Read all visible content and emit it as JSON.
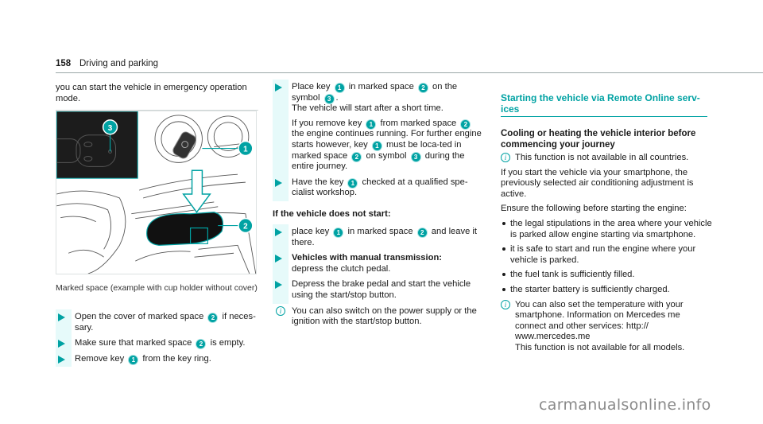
{
  "header": {
    "page_number": "158",
    "section": "Driving and parking"
  },
  "col1": {
    "intro": "you can start the vehicle in emergency operation mode.",
    "figure": {
      "callouts": [
        "1",
        "2",
        "3"
      ],
      "accent_color": "#00a2a3"
    },
    "caption": "Marked space (example with cup holder without cover)",
    "steps": [
      {
        "parts": [
          "Open the cover of marked space ",
          "2",
          " if neces-sary."
        ]
      },
      {
        "parts": [
          "Make sure that marked space ",
          "2",
          " is empty."
        ]
      },
      {
        "parts": [
          "Remove key ",
          "1",
          " from the key ring."
        ]
      }
    ]
  },
  "col2": {
    "step1": {
      "a": "Place key ",
      "n1": "1",
      "b": " in marked space ",
      "n2": "2",
      "c": " on the symbol ",
      "n3": "3",
      "d": ".",
      "line2": "The vehicle will start after a short time.",
      "para_a": "If you remove key ",
      "para_n1": "1",
      "para_b": " from marked space ",
      "para_n2": "2",
      "para_c": " the engine continues running. For further engine starts however, key ",
      "para_n3": "1",
      "para_d": " must be loca-ted in marked space ",
      "para_n4": "2",
      "para_e": " on symbol ",
      "para_n5": "3",
      "para_f": " during the entire journey."
    },
    "step2": {
      "a": "Have the key ",
      "n1": "1",
      "b": " checked at a qualified spe-cialist workshop."
    },
    "subheading": "If the vehicle does not start:",
    "step3": {
      "a": "place key ",
      "n1": "1",
      "b": " in marked space ",
      "n2": "2",
      "c": " and leave it there."
    },
    "step4": {
      "bold": "Vehicles with manual transmission:",
      "text": "depress the clutch pedal."
    },
    "step5": {
      "text": "Depress the brake pedal and start the vehicle using the start/stop button."
    },
    "info": "You can also switch on the power supply or the ignition with the start/stop button."
  },
  "col3": {
    "heading": "Starting the vehicle via Remote Online serv-ices",
    "subheading": "Cooling or heating the vehicle interior before commencing your journey",
    "info1": "This function is not available in all countries.",
    "para1": "If you start the vehicle via your smartphone, the previously selected air conditioning adjustment is active.",
    "para2": "Ensure the following before starting the engine:",
    "bullets": [
      "the legal stipulations in the area where your vehicle is parked allow engine starting via smartphone.",
      "it is safe to start and run the engine where your vehicle is parked.",
      "the fuel tank is sufficiently filled.",
      "the starter battery is sufficiently charged."
    ],
    "info2": "You can also set the temperature with your smartphone. Information on Mercedes me connect and other services: http://\nwww.mercedes.me\nThis function is not available for all models."
  },
  "watermark": "carmanualsonline.info",
  "colors": {
    "accent": "#00a2a3",
    "bullet_bg": "#e6fafa"
  }
}
